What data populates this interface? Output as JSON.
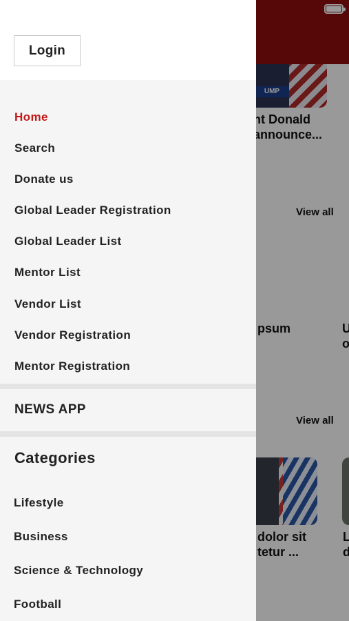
{
  "background": {
    "article1_title_line1": "nt Donald",
    "article1_title_line2": "announce...",
    "view_all_1": "View all",
    "card_title_fragment": "psum",
    "card_edge_fragment_1": "U",
    "card_edge_fragment_2": "o",
    "view_all_2": "View all",
    "article2_title_line1": "dolor sit",
    "article2_title_line2": "tetur ...",
    "article3_edge_1": "L",
    "article3_edge_2": "d",
    "image_badge": "UMP"
  },
  "drawer": {
    "login_label": "Login",
    "menu": [
      {
        "label": "Home",
        "active": true
      },
      {
        "label": "Search"
      },
      {
        "label": "Donate us"
      },
      {
        "label": "Global Leader Registration"
      },
      {
        "label": "Global Leader List"
      },
      {
        "label": "Mentor List"
      },
      {
        "label": "Vendor List"
      },
      {
        "label": "Vendor Registration"
      },
      {
        "label": "Mentor Registration"
      }
    ],
    "news_app_label": "NEWS APP",
    "categories_label": "Categories",
    "categories": [
      "Lifestyle",
      "Business",
      "Science & Technology",
      "Football"
    ]
  },
  "colors": {
    "accent": "#c41919",
    "header_bg": "#8f0d0d"
  }
}
